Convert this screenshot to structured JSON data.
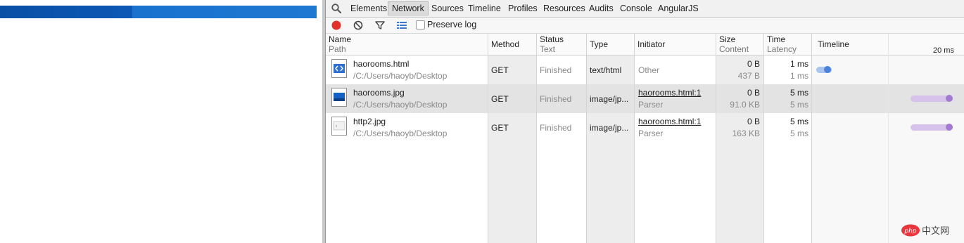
{
  "devtools": {
    "tabs": [
      {
        "label": "Elements"
      },
      {
        "label": "Network"
      },
      {
        "label": "Sources"
      },
      {
        "label": "Timeline"
      },
      {
        "label": "Profiles"
      },
      {
        "label": "Resources"
      },
      {
        "label": "Audits"
      },
      {
        "label": "Console"
      },
      {
        "label": "AngularJS"
      }
    ],
    "active_tab": "Network",
    "preserve_log": {
      "label": "Preserve log",
      "checked": false
    }
  },
  "columns": {
    "name": {
      "title": "Name",
      "sub": "Path"
    },
    "method": {
      "title": "Method"
    },
    "status": {
      "title": "Status",
      "sub": "Text"
    },
    "type": {
      "title": "Type"
    },
    "initiator": {
      "title": "Initiator"
    },
    "size": {
      "title": "Size",
      "sub": "Content"
    },
    "time": {
      "title": "Time",
      "sub": "Latency"
    },
    "timeline": {
      "title": "Timeline",
      "scale": "20 ms"
    }
  },
  "requests": [
    {
      "name": "haorooms.html",
      "path": "/C:/Users/haoyb/Desktop",
      "method": "GET",
      "status": "Finished",
      "type": "text/html",
      "initiator": "Other",
      "initiator_sub": "",
      "size": "0 B",
      "content": "437 B",
      "time": "1 ms",
      "latency": "1 ms",
      "icon": "html-file-icon"
    },
    {
      "name": "haorooms.jpg",
      "path": "/C:/Users/haoyb/Desktop",
      "method": "GET",
      "status": "Finished",
      "type": "image/jp...",
      "initiator": "haorooms.html:1",
      "initiator_sub": "Parser",
      "size": "0 B",
      "content": "91.0 KB",
      "time": "5 ms",
      "latency": "5 ms",
      "icon": "image-file-icon"
    },
    {
      "name": "http2.jpg",
      "path": "/C:/Users/haoyb/Desktop",
      "method": "GET",
      "status": "Finished",
      "type": "image/jp...",
      "initiator": "haorooms.html:1",
      "initiator_sub": "Parser",
      "size": "0 B",
      "content": "163 KB",
      "time": "5 ms",
      "latency": "5 ms",
      "icon": "image-file-icon"
    }
  ],
  "watermark": {
    "text": "php中文网"
  },
  "colors": {
    "record": "#e0332b",
    "html_bar": "#5a8fe0",
    "image_bar": "#b08ad6"
  }
}
